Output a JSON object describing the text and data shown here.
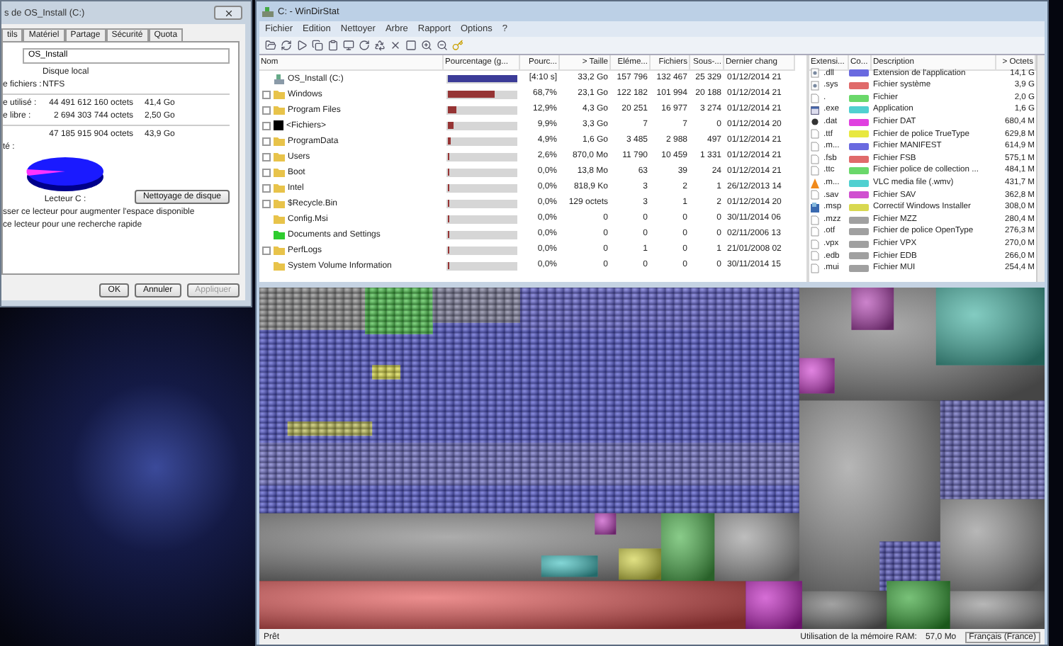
{
  "dialog": {
    "title": "s de OS_Install (C:)",
    "tabs": [
      {
        "label": "tils",
        "selected": false
      },
      {
        "label": "Matériel",
        "selected": false
      },
      {
        "label": "Partage",
        "selected": false
      },
      {
        "label": "Sécurité",
        "selected": false
      },
      {
        "label": "Quota",
        "selected": false
      }
    ],
    "name_value": "OS_Install",
    "type_value": "Disque local",
    "fs_label": "e fichiers :",
    "fs_value": "NTFS",
    "stats": [
      {
        "label": "e utilisé :",
        "bytes": "44 491 612 160 octets",
        "size": "41,4 Go"
      },
      {
        "label": "e libre :",
        "bytes": "2 694 303 744 octets",
        "size": "2,50 Go"
      }
    ],
    "capacity": {
      "label": "té :",
      "bytes": "47 185 915 904 octets",
      "size": "43,9 Go"
    },
    "drive_label": "Lecteur C :",
    "cleanup_button": "Nettoyage de disque",
    "options": [
      "sser ce lecteur pour augmenter l'espace disponible",
      "ce lecteur pour une recherche rapide"
    ],
    "buttons": [
      {
        "label": "OK",
        "disabled": false
      },
      {
        "label": "Annuler",
        "disabled": false
      },
      {
        "label": "Appliquer",
        "disabled": true
      }
    ]
  },
  "window": {
    "title": "C: - WinDirStat",
    "menu": [
      "Fichier",
      "Edition",
      "Nettoyer",
      "Arbre",
      "Rapport",
      "Options",
      "?"
    ]
  },
  "tree": {
    "columns": [
      "Nom",
      "Pourcentage (g...",
      "Pourc...",
      "> Taille",
      "Eléme...",
      "Fichiers",
      "Sous-...",
      "Dernier chang"
    ],
    "rows": [
      {
        "kind": "drive",
        "expandable": false,
        "name": "OS_Install (C:)",
        "level": 1,
        "percent": "[4:10 s]",
        "size": "33,2 Go",
        "items": "157 796",
        "files": "132 467",
        "subdirs": "25 329",
        "date": "01/12/2014 21"
      },
      {
        "kind": "folder",
        "expandable": true,
        "name": "Windows",
        "level": 0.687,
        "percent": "68,7%",
        "size": "23,1 Go",
        "items": "122 182",
        "files": "101 994",
        "subdirs": "20 188",
        "date": "01/12/2014 21"
      },
      {
        "kind": "folder",
        "expandable": true,
        "name": "Program Files",
        "level": 0.129,
        "percent": "12,9%",
        "size": "4,3 Go",
        "items": "20 251",
        "files": "16 977",
        "subdirs": "3 274",
        "date": "01/12/2014 21"
      },
      {
        "kind": "files",
        "expandable": true,
        "name": "<Fichiers>",
        "level": 0.099,
        "percent": "9,9%",
        "size": "3,3 Go",
        "items": "7",
        "files": "7",
        "subdirs": "0",
        "date": "01/12/2014 20"
      },
      {
        "kind": "folder",
        "expandable": true,
        "name": "ProgramData",
        "level": 0.049,
        "percent": "4,9%",
        "size": "1,6 Go",
        "items": "3 485",
        "files": "2 988",
        "subdirs": "497",
        "date": "01/12/2014 21"
      },
      {
        "kind": "folder",
        "expandable": true,
        "name": "Users",
        "level": 0.026,
        "percent": "2,6%",
        "size": "870,0 Mo",
        "items": "11 790",
        "files": "10 459",
        "subdirs": "1 331",
        "date": "01/12/2014 21"
      },
      {
        "kind": "folder",
        "expandable": true,
        "name": "Boot",
        "level": 0,
        "percent": "0,0%",
        "size": "13,8 Mo",
        "items": "63",
        "files": "39",
        "subdirs": "24",
        "date": "01/12/2014 21"
      },
      {
        "kind": "folder",
        "expandable": true,
        "name": "Intel",
        "level": 0,
        "percent": "0,0%",
        "size": "818,9 Ko",
        "items": "3",
        "files": "2",
        "subdirs": "1",
        "date": "26/12/2013 14"
      },
      {
        "kind": "folder",
        "expandable": true,
        "name": "$Recycle.Bin",
        "level": 0,
        "percent": "0,0%",
        "size": "129 octets",
        "items": "3",
        "files": "1",
        "subdirs": "2",
        "date": "01/12/2014 20"
      },
      {
        "kind": "folder",
        "expandable": false,
        "name": "Config.Msi",
        "level": 0,
        "percent": "0,0%",
        "size": "0",
        "items": "0",
        "files": "0",
        "subdirs": "0",
        "date": "30/11/2014 06"
      },
      {
        "kind": "junction",
        "expandable": false,
        "name": "Documents and Settings",
        "level": 0,
        "percent": "0,0%",
        "size": "0",
        "items": "0",
        "files": "0",
        "subdirs": "0",
        "date": "02/11/2006 13"
      },
      {
        "kind": "folder",
        "expandable": true,
        "name": "PerfLogs",
        "level": 0,
        "percent": "0,0%",
        "size": "0",
        "items": "1",
        "files": "0",
        "subdirs": "1",
        "date": "21/01/2008 02"
      },
      {
        "kind": "folder",
        "expandable": false,
        "name": "System Volume Information",
        "level": 0,
        "percent": "0,0%",
        "size": "0",
        "items": "0",
        "files": "0",
        "subdirs": "0",
        "date": "30/11/2014 15"
      }
    ]
  },
  "extensions": {
    "columns": [
      "Extensi...",
      "Co...",
      "Description",
      "> Octets"
    ],
    "rows": [
      {
        "kind": "system",
        "ext": ".dll",
        "color": "#6a6ae0",
        "description": "Extension de l'application",
        "size": "14,1 G"
      },
      {
        "kind": "system",
        "ext": ".sys",
        "color": "#e06a6a",
        "description": "Fichier système",
        "size": "3,9 G"
      },
      {
        "kind": "blank",
        "ext": ".",
        "color": "#6ad86a",
        "description": "Fichier",
        "size": "2,0 G"
      },
      {
        "kind": "app",
        "ext": ".exe",
        "color": "#50d0d0",
        "description": "Application",
        "size": "1,6 G"
      },
      {
        "kind": "dat",
        "ext": ".dat",
        "color": "#e040e0",
        "description": "Fichier DAT",
        "size": "680,4 M"
      },
      {
        "kind": "blank",
        "ext": ".ttf",
        "color": "#e8e840",
        "description": "Fichier de police TrueType",
        "size": "629,8 M"
      },
      {
        "kind": "blank",
        "ext": ".m...",
        "color": "#6a6ae0",
        "description": "Fichier MANIFEST",
        "size": "614,9 M"
      },
      {
        "kind": "blank",
        "ext": ".fsb",
        "color": "#e06a6a",
        "description": "Fichier FSB",
        "size": "575,1 M"
      },
      {
        "kind": "blank",
        "ext": ".ttc",
        "color": "#6ad86a",
        "description": "Fichier police de collection ...",
        "size": "484,1 M"
      },
      {
        "kind": "media",
        "ext": ".m...",
        "color": "#50d0d0",
        "description": "VLC media file (.wmv)",
        "size": "431,7 M"
      },
      {
        "kind": "blank",
        "ext": ".sav",
        "color": "#d050d0",
        "description": "Fichier SAV",
        "size": "362,8 M"
      },
      {
        "kind": "installer",
        "ext": ".msp",
        "color": "#d8d850",
        "description": "Correctif Windows Installer",
        "size": "308,0 M"
      },
      {
        "kind": "blank",
        "ext": ".mzz",
        "color": "#a0a0a0",
        "description": "Fichier MZZ",
        "size": "280,4 M"
      },
      {
        "kind": "blank",
        "ext": ".otf",
        "color": "#a0a0a0",
        "description": "Fichier de police OpenType",
        "size": "276,3 M"
      },
      {
        "kind": "blank",
        "ext": ".vpx",
        "color": "#a0a0a0",
        "description": "Fichier VPX",
        "size": "270,0 M"
      },
      {
        "kind": "blank",
        "ext": ".edb",
        "color": "#a0a0a0",
        "description": "Fichier EDB",
        "size": "266,0 M"
      },
      {
        "kind": "blank",
        "ext": ".mui",
        "color": "#a0a0a0",
        "description": "Fichier MUI",
        "size": "254,4 M"
      }
    ]
  },
  "status_bar": {
    "text": "Prêt",
    "memory_label": "Utilisation de la mémoire RAM:",
    "memory_value": "57,0 Mo",
    "language": "Français (France)"
  }
}
